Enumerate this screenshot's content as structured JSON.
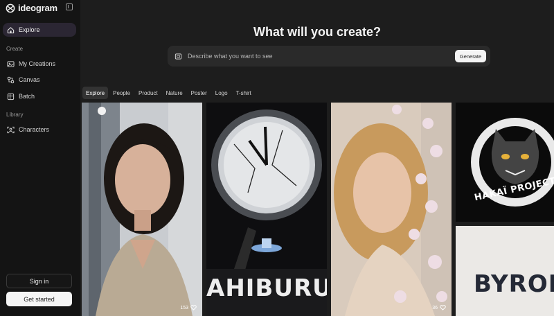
{
  "brand": {
    "name": "ideogram"
  },
  "nav": {
    "explore_label": "Explore",
    "create_section": "Create",
    "my_creations_label": "My Creations",
    "canvas_label": "Canvas",
    "batch_label": "Batch",
    "library_section": "Library",
    "characters_label": "Characters"
  },
  "auth": {
    "signin_label": "Sign in",
    "get_started_label": "Get started"
  },
  "main": {
    "headline": "What will you create?",
    "prompt_placeholder": "Describe what you want to see",
    "generate_label": "Generate",
    "tabs": [
      "Explore",
      "People",
      "Product",
      "Nature",
      "Poster",
      "Logo",
      "T-shirt"
    ]
  },
  "gallery": {
    "card1_likes": "153",
    "card2_title": "AHIBURU",
    "card3_likes": "36",
    "card4_text": "HAKAÏ PROJECT",
    "card5_text": "BYRON"
  },
  "colors": {
    "sidebar_bg": "#141414",
    "main_bg": "#1d1d1d",
    "active_nav": "#2b2633",
    "accent_white": "#f5f5f5"
  }
}
